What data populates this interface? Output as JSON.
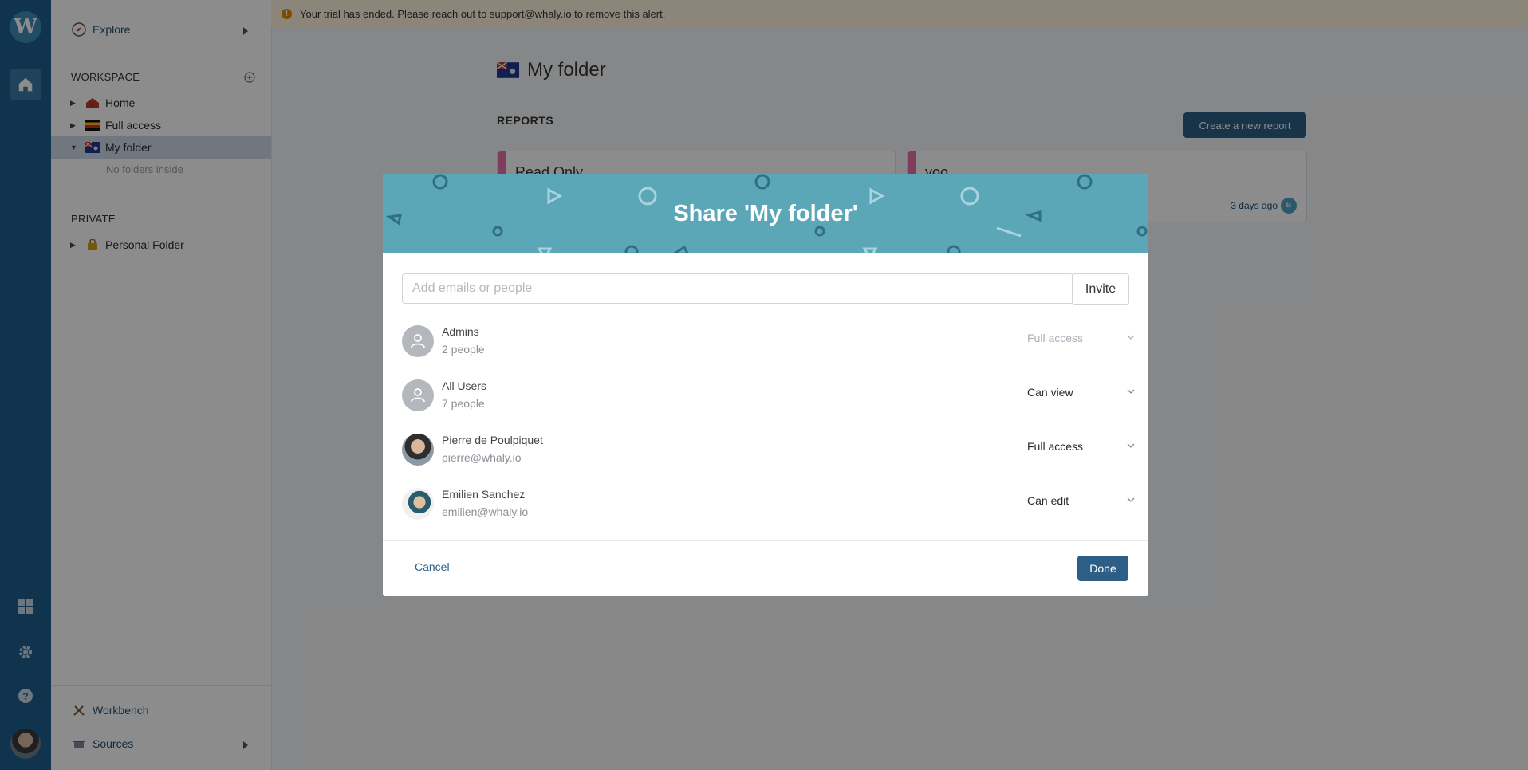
{
  "rail": {
    "logo_letter": "W"
  },
  "sidebar": {
    "explore_label": "Explore",
    "workspace_title": "WORKSPACE",
    "workspace_items": [
      {
        "label": "Home"
      },
      {
        "label": "Full access"
      },
      {
        "label": "My folder"
      }
    ],
    "no_folders_text": "No folders inside",
    "private_title": "PRIVATE",
    "private_items": [
      {
        "label": "Personal Folder"
      }
    ],
    "workbench_label": "Workbench",
    "sources_label": "Sources"
  },
  "banner": {
    "icon": "!",
    "text": "Your trial has ended. Please reach out to support@whaly.io to remove this alert."
  },
  "main": {
    "folder_title": "My folder",
    "reports_label": "REPORTS",
    "create_button": "Create a new report",
    "cards": [
      {
        "title": "Read Only",
        "meta": "",
        "badge": ""
      },
      {
        "title": "yoo",
        "meta": "3 days ago",
        "badge": "B"
      }
    ]
  },
  "modal": {
    "title": "Share 'My folder'",
    "input_placeholder": "Add emails or people",
    "invite_button": "Invite",
    "members": [
      {
        "name": "Admins",
        "sub": "2 people",
        "permission": "Full access",
        "kind": "group",
        "disabled": true
      },
      {
        "name": "All Users",
        "sub": "7 people",
        "permission": "Can view",
        "kind": "group",
        "disabled": false
      },
      {
        "name": "Pierre de Poulpiquet",
        "sub": "pierre@whaly.io",
        "permission": "Full access",
        "kind": "user",
        "disabled": false
      },
      {
        "name": "Emilien Sanchez",
        "sub": "emilien@whaly.io",
        "permission": "Can edit",
        "kind": "user",
        "disabled": false
      }
    ],
    "cancel_button": "Cancel",
    "done_button": "Done"
  },
  "colors": {
    "rail": "#1e5f8f",
    "accent": "#2d5f86",
    "modal_header": "#5ba7b8",
    "banner": "#fdf4dc"
  }
}
